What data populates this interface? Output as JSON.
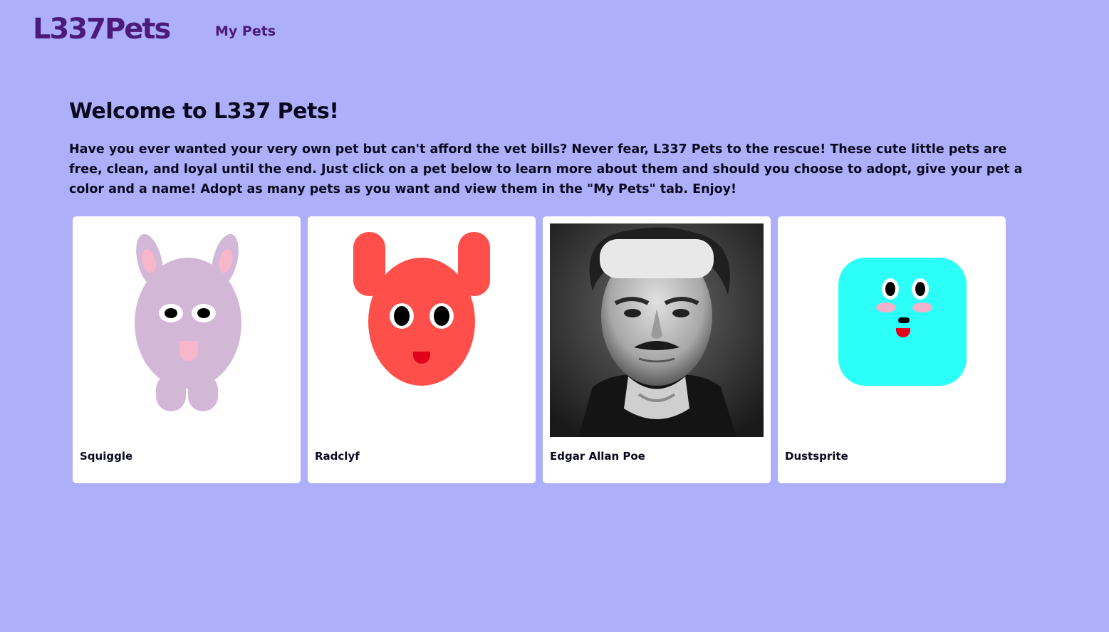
{
  "nav": {
    "logo": "L337Pets",
    "links": [
      {
        "label": "My Pets"
      }
    ]
  },
  "main": {
    "title": "Welcome to L337 Pets!",
    "intro": "Have you ever wanted your very own pet but can't afford the vet bills? Never fear, L337 Pets to the rescue! These cute little pets are free, clean, and loyal until the end. Just click on a pet below to learn more about them and should you choose to adopt, give your pet a color and a name! Adopt as many pets as you want and view them in the \"My Pets\" tab. Enjoy!"
  },
  "pets": [
    {
      "name": "Squiggle",
      "image": "bunny-pet-illustration",
      "color": "#d2b8d6"
    },
    {
      "name": "Radclyf",
      "image": "round-eared-pet-illustration",
      "color": "#ff4f4a"
    },
    {
      "name": "Edgar Allan Poe",
      "image": "grayscale-portrait-photo",
      "color": "#555555"
    },
    {
      "name": "Dustsprite",
      "image": "square-blob-pet-illustration",
      "color": "#2bfff7"
    }
  ],
  "colors": {
    "background": "#adaffa",
    "brand": "#4b1a7a",
    "card": "#ffffff"
  }
}
